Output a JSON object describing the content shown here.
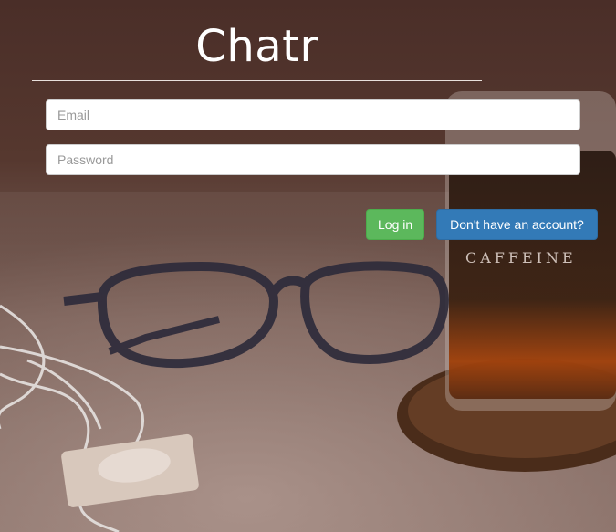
{
  "app": {
    "title": "Chatr"
  },
  "login_form": {
    "email_placeholder": "Email",
    "password_placeholder": "Password",
    "email_value": "",
    "password_value": "",
    "login_label": "Log in",
    "register_label": "Don't have an account?"
  },
  "colors": {
    "login_button": "#5cb85c",
    "register_button": "#337ab7",
    "text_on_buttons": "#ffffff"
  },
  "background": {
    "description_icon": "coffee-glasses-photo"
  }
}
